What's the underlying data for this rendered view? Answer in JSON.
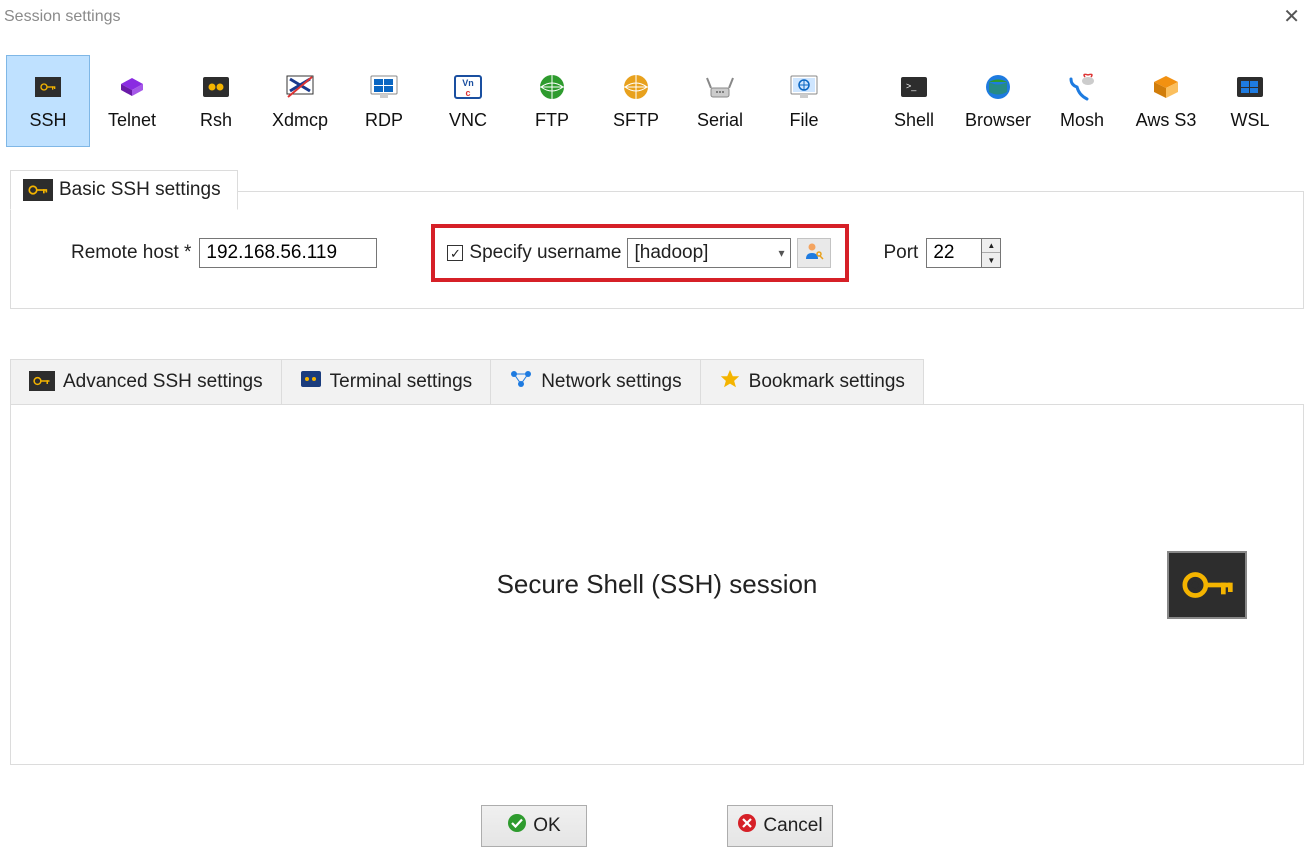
{
  "window": {
    "title": "Session settings"
  },
  "types": [
    {
      "id": "ssh",
      "label": "SSH",
      "selected": true
    },
    {
      "id": "telnet",
      "label": "Telnet"
    },
    {
      "id": "rsh",
      "label": "Rsh"
    },
    {
      "id": "xdmcp",
      "label": "Xdmcp"
    },
    {
      "id": "rdp",
      "label": "RDP"
    },
    {
      "id": "vnc",
      "label": "VNC"
    },
    {
      "id": "ftp",
      "label": "FTP"
    },
    {
      "id": "sftp",
      "label": "SFTP"
    },
    {
      "id": "serial",
      "label": "Serial"
    },
    {
      "id": "file",
      "label": "File"
    },
    {
      "id": "shell",
      "label": "Shell"
    },
    {
      "id": "browser",
      "label": "Browser"
    },
    {
      "id": "mosh",
      "label": "Mosh"
    },
    {
      "id": "awss3",
      "label": "Aws S3"
    },
    {
      "id": "wsl",
      "label": "WSL"
    }
  ],
  "basic": {
    "legend": "Basic SSH settings",
    "remote_host_label": "Remote host *",
    "remote_host_value": "192.168.56.119",
    "specify_username_label": "Specify username",
    "specify_username_checked": true,
    "username_value": "[hadoop]",
    "port_label": "Port",
    "port_value": "22"
  },
  "tabs": {
    "advanced": "Advanced SSH settings",
    "terminal": "Terminal settings",
    "network": "Network settings",
    "bookmark": "Bookmark settings"
  },
  "panel": {
    "title": "Secure Shell (SSH) session"
  },
  "footer": {
    "ok": "OK",
    "cancel": "Cancel"
  }
}
